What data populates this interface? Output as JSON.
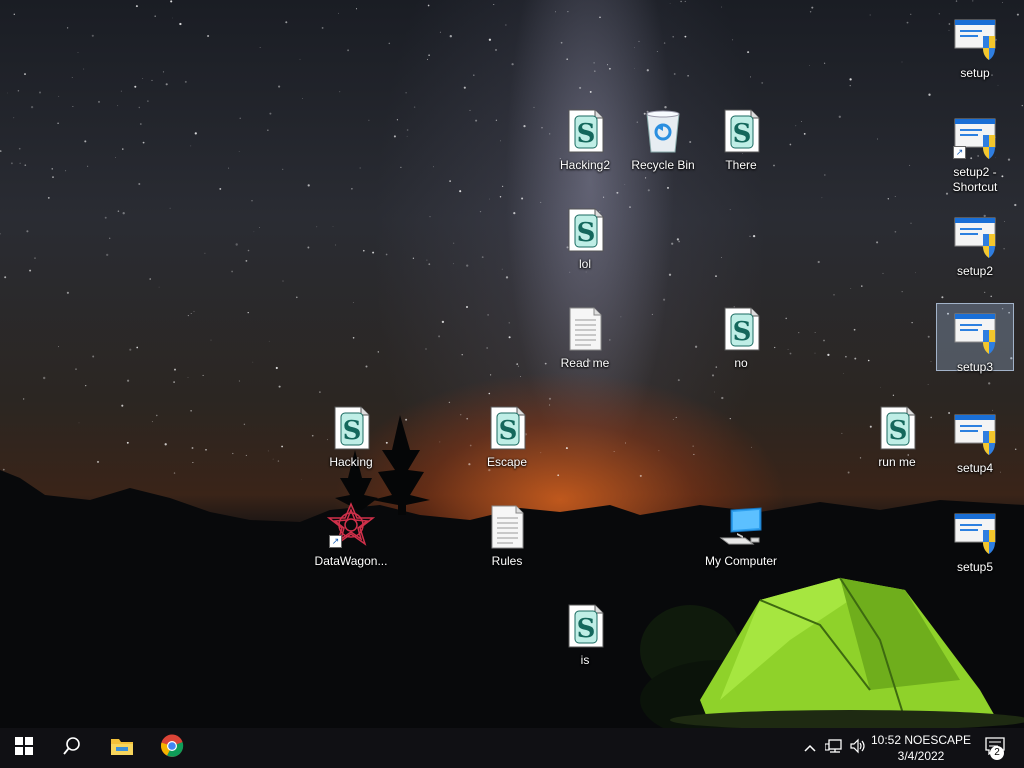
{
  "desktop": {
    "icons": [
      {
        "label": "setup",
        "type": "installer"
      },
      {
        "label": "setup2 - Shortcut",
        "type": "installer-shortcut"
      },
      {
        "label": "setup2",
        "type": "installer"
      },
      {
        "label": "setup3",
        "type": "installer",
        "selected": true
      },
      {
        "label": "setup4",
        "type": "installer"
      },
      {
        "label": "setup5",
        "type": "installer"
      },
      {
        "label": "Hacking2",
        "type": "script"
      },
      {
        "label": "Recycle Bin",
        "type": "recycle-bin"
      },
      {
        "label": "There",
        "type": "script"
      },
      {
        "label": "lol",
        "type": "script"
      },
      {
        "label": "Read me",
        "type": "text-file"
      },
      {
        "label": "no",
        "type": "script"
      },
      {
        "label": "Hacking",
        "type": "script"
      },
      {
        "label": "Escape",
        "type": "script"
      },
      {
        "label": "run me",
        "type": "script"
      },
      {
        "label": "DataWagon...",
        "type": "app-shortcut"
      },
      {
        "label": "Rules",
        "type": "text-file"
      },
      {
        "label": "My Computer",
        "type": "computer"
      },
      {
        "label": "is",
        "type": "script"
      }
    ]
  },
  "taskbar": {
    "start_icon": "windows-logo-icon",
    "search_icon": "search-icon",
    "pinned": [
      {
        "name": "File Explorer",
        "icon": "folder-icon"
      },
      {
        "name": "Google Chrome",
        "icon": "chrome-icon"
      }
    ],
    "tray": {
      "chevron_icon": "chevron-up-icon",
      "network_icon": "network-icon",
      "volume_icon": "volume-icon"
    },
    "clock": {
      "time": "10:52",
      "user": "NOESCAPE",
      "date": "3/4/2022"
    },
    "notifications": {
      "icon": "action-center-icon",
      "count": "2"
    }
  },
  "colors": {
    "taskbar": "#101014",
    "selection": "#96afcd",
    "tent": "#8fd22a"
  }
}
